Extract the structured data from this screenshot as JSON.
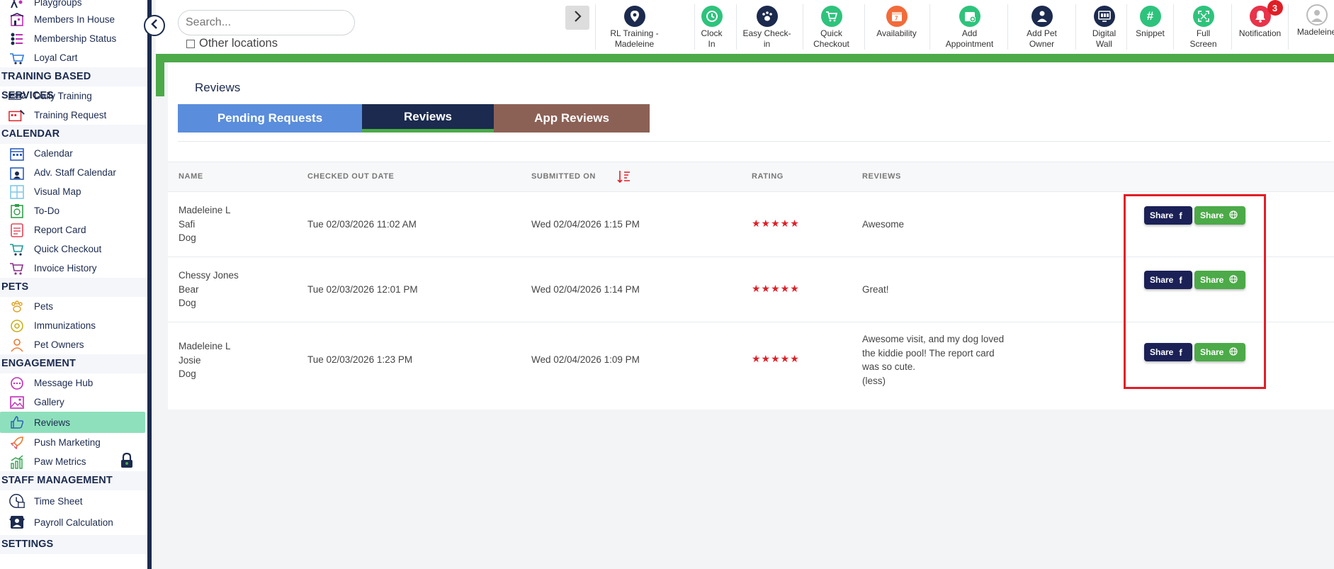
{
  "sidebar": {
    "top_items": [
      {
        "label": "Playgroups",
        "icon": "playgroups-icon"
      },
      {
        "label": "Members In House",
        "icon": "building-icon"
      },
      {
        "label": "Membership Status",
        "icon": "membership-list-icon"
      },
      {
        "label": "Loyal Cart",
        "icon": "loyal-cart-icon"
      }
    ],
    "sections": {
      "training": "TRAINING BASED SERVICES",
      "calendar": "CALENDAR",
      "pets": "PETS",
      "engagement": "ENGAGEMENT",
      "staff": "STAFF MANAGEMENT",
      "settings": "SETTINGS"
    },
    "training_items": [
      {
        "label": "Daily Training"
      },
      {
        "label": "Training Request"
      }
    ],
    "calendar_items": [
      {
        "label": "Calendar"
      },
      {
        "label": "Adv. Staff Calendar"
      },
      {
        "label": "Visual Map"
      },
      {
        "label": "To-Do"
      },
      {
        "label": "Report Card"
      },
      {
        "label": "Quick Checkout"
      },
      {
        "label": "Invoice History"
      }
    ],
    "pets_items": [
      {
        "label": "Pets"
      },
      {
        "label": "Immunizations"
      },
      {
        "label": "Pet Owners"
      }
    ],
    "engagement_items": [
      {
        "label": "Message Hub"
      },
      {
        "label": "Gallery"
      },
      {
        "label": "Reviews"
      },
      {
        "label": "Push Marketing"
      },
      {
        "label": "Paw Metrics"
      }
    ],
    "staff_items": [
      {
        "label": "Time Sheet"
      },
      {
        "label": "Payroll Calculation"
      }
    ]
  },
  "topbar": {
    "search_placeholder": "Search...",
    "other_locations": "Other locations",
    "tools": [
      {
        "l1": "RL Training -",
        "l2": "Madeleine",
        "color": "#1b2a4e"
      },
      {
        "l1": "Clock",
        "l2": "In",
        "color": "#2ec37c"
      },
      {
        "l1": "Easy Check-",
        "l2": "in",
        "color": "#1b2a4e"
      },
      {
        "l1": "Quick",
        "l2": "Checkout",
        "color": "#2ec37c"
      },
      {
        "l1": "Availability",
        "l2": "",
        "color": "#f26b3a"
      },
      {
        "l1": "Add",
        "l2": "Appointment",
        "color": "#2ec37c"
      },
      {
        "l1": "Add Pet",
        "l2": "Owner",
        "color": "#1b2a4e"
      },
      {
        "l1": "Digital",
        "l2": "Wall",
        "color": "#1b2a4e"
      },
      {
        "l1": "Snippet",
        "l2": "",
        "color": "#2ec37c"
      },
      {
        "l1": "Full",
        "l2": "Screen",
        "color": "#2ec37c"
      },
      {
        "l1": "Notification",
        "l2": "",
        "color": "#e8334a"
      },
      {
        "l1": "Madeleine",
        "l2": "",
        "color": "#ffffff"
      }
    ],
    "notification_count": "3"
  },
  "main": {
    "title": "Reviews",
    "tabs": [
      "Pending Requests",
      "Reviews",
      "App Reviews"
    ],
    "columns": [
      "NAME",
      "CHECKED OUT DATE",
      "SUBMITTED ON",
      "RATING",
      "REVIEWS"
    ],
    "rows": [
      {
        "owner": "Madeleine L",
        "pet": "Safi",
        "species": "Dog",
        "checked_out": "Tue 02/03/2026 11:02 AM",
        "submitted": "Wed 02/04/2026 1:15 PM",
        "rating": "★★★★★",
        "review": "Awesome",
        "review_more": ""
      },
      {
        "owner": "Chessy Jones",
        "pet": "Bear",
        "species": "Dog",
        "checked_out": "Tue 02/03/2026 12:01 PM",
        "submitted": "Wed 02/04/2026 1:14 PM",
        "rating": "★★★★★",
        "review": "Great!",
        "review_more": ""
      },
      {
        "owner": "Madeleine L",
        "pet": "Josie",
        "species": "Dog",
        "checked_out": "Tue 02/03/2026 1:23 PM",
        "submitted": "Wed 02/04/2026 1:09 PM",
        "rating": "★★★★★",
        "review": "Awesome visit, and my dog loved the kiddie pool! The report card was so cute.",
        "review_more": "(less)"
      }
    ],
    "share_label": "Share"
  }
}
